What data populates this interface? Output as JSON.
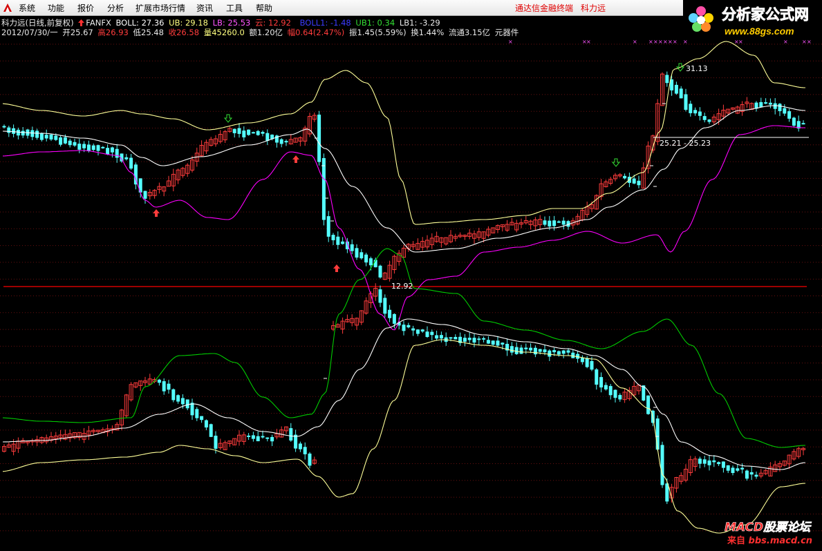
{
  "menu": {
    "items": [
      "系统",
      "功能",
      "报价",
      "分析",
      "扩展市场行情",
      "资讯",
      "工具",
      "帮助"
    ],
    "brand": "通达信金融终端",
    "stock_name": "科力远"
  },
  "info_line1": {
    "title": "科力远(日线,前复权)",
    "indicator": "FANFX",
    "boll_label": "BOLL: 27.36",
    "ub_label": "UB: 29.18",
    "lb_label": "LB: 25.53",
    "yun_label": "云: 12.92",
    "boll1_label": "BOLL1: -1.48",
    "ub1_label": "UB1: 0.34",
    "lb1_label": "LB1: -3.29"
  },
  "info_line2": {
    "date": "2012/07/30/一",
    "open": "开25.67",
    "high": "高26.93",
    "low": "低25.48",
    "close": "收26.58",
    "volume": "量45260.0",
    "amount": "额1.20亿",
    "change": "幅0.64(2.47%)",
    "amplitude": "振1.45(5.59%)",
    "turnover": "换1.44%",
    "float": "流通3.15亿",
    "sector": "元器件"
  },
  "annotations": {
    "high_label": "31.13",
    "range_label": "25.21 - 25.23",
    "mid_label": "12.92"
  },
  "watermark_top": {
    "line1": "分析家公式网",
    "line2": "www.88gs.com"
  },
  "watermark_bottom": {
    "line1": "MACD股票论坛",
    "line2_prefix": "来自",
    "line2": "bbs.macd.cn"
  },
  "colors": {
    "background": "#000000",
    "up": "#ff3c3c",
    "down": "#54ffff",
    "boll_mid": "#ffffff",
    "boll_upper": "#ffff99",
    "boll_lower": "#ff00ff",
    "boll1_upper": "#00cc00",
    "axis_red": "#d00000",
    "label_magenta": "#ff55ff"
  },
  "icons": [
    "tdx-logo-icon",
    "up-arrow-icon",
    "down-arrow-icon",
    "x-marker-icon"
  ]
}
